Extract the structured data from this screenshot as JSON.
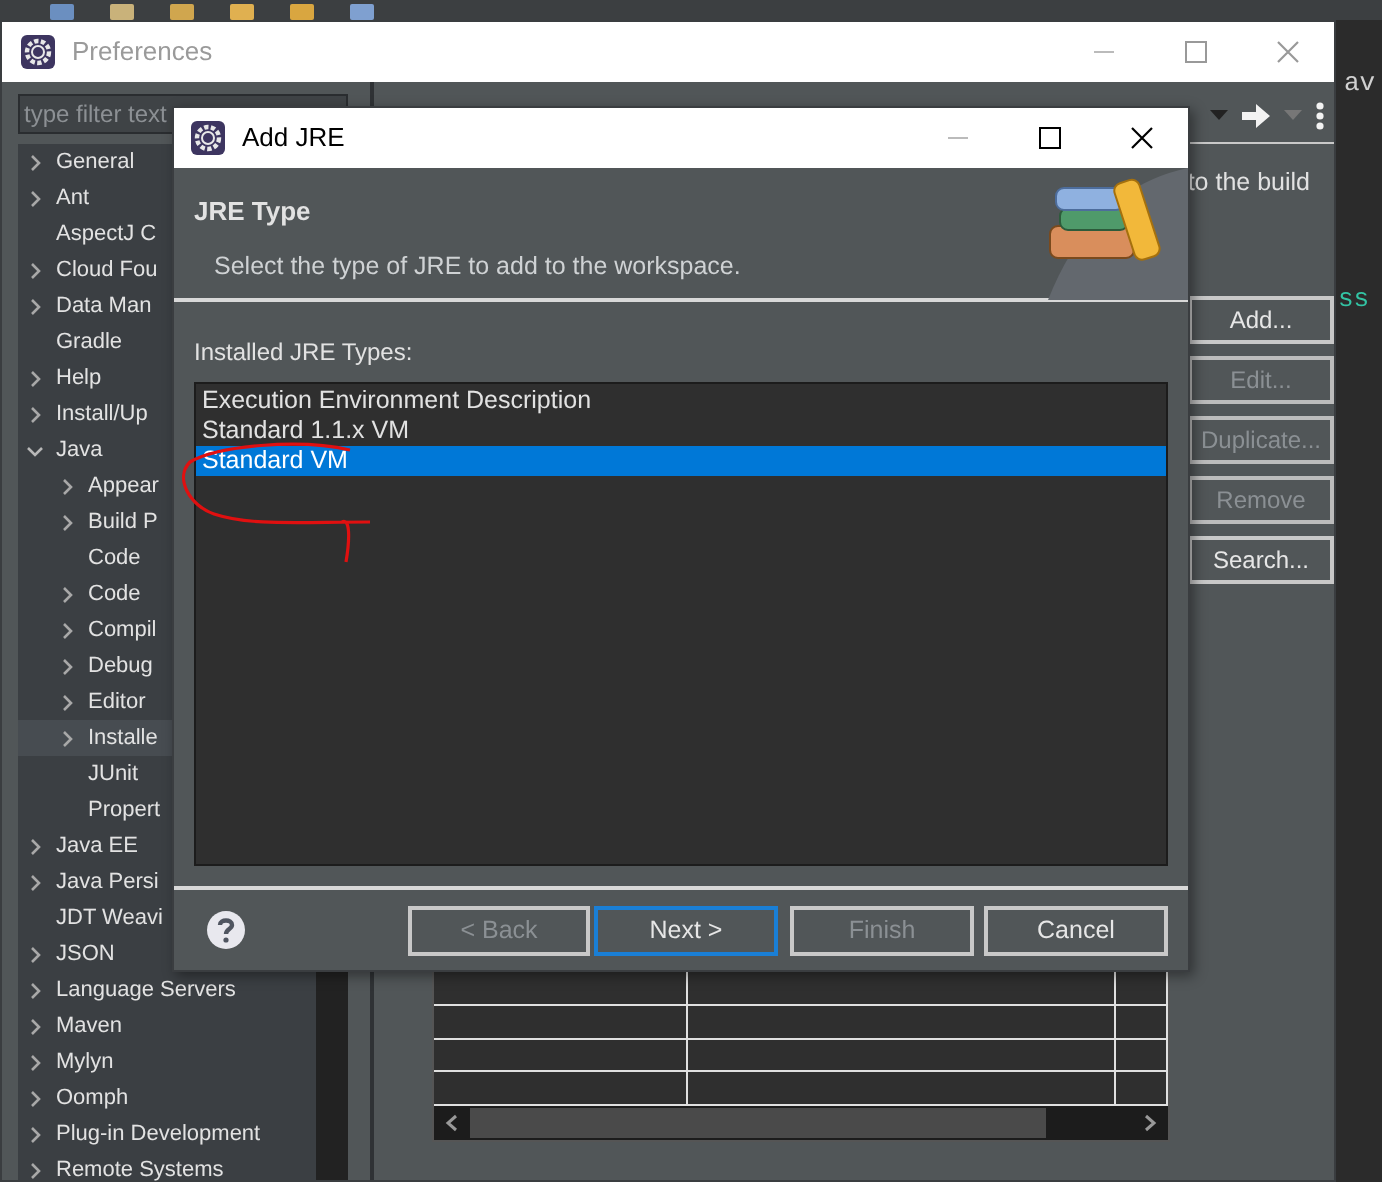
{
  "editor": {
    "fragments": [
      {
        "text": "av",
        "kind": "plain"
      },
      {
        "text": "ss",
        "kind": "keyword"
      }
    ]
  },
  "preferences": {
    "title": "Preferences",
    "filter": {
      "placeholder": "type filter text"
    },
    "tree": [
      {
        "label": "General",
        "expanded": false,
        "selected": false
      },
      {
        "label": "Ant",
        "expanded": false,
        "selected": false
      },
      {
        "label": "AspectJ C",
        "selected": false
      },
      {
        "label": "Cloud Fou",
        "expanded": false,
        "selected": false
      },
      {
        "label": "Data Man",
        "expanded": false,
        "selected": false
      },
      {
        "label": "Gradle",
        "selected": false
      },
      {
        "label": "Help",
        "expanded": false,
        "selected": false
      },
      {
        "label": "Install/Up",
        "expanded": false,
        "selected": false
      },
      {
        "label": "Java",
        "expanded": true,
        "selected": false,
        "children": [
          {
            "label": "Appear",
            "expanded": false,
            "selected": false
          },
          {
            "label": "Build P",
            "expanded": false,
            "selected": false
          },
          {
            "label": "Code",
            "selected": false
          },
          {
            "label": "Code",
            "expanded": false,
            "selected": false
          },
          {
            "label": "Compil",
            "expanded": false,
            "selected": false
          },
          {
            "label": "Debug",
            "expanded": false,
            "selected": false
          },
          {
            "label": "Editor",
            "expanded": false,
            "selected": false
          },
          {
            "label": "Installe",
            "expanded": false,
            "selected": true
          },
          {
            "label": "JUnit",
            "selected": false
          },
          {
            "label": "Propert",
            "selected": false
          }
        ]
      },
      {
        "label": "Java EE",
        "expanded": false,
        "selected": false
      },
      {
        "label": "Java Persi",
        "expanded": false,
        "selected": false
      },
      {
        "label": "JDT Weavi",
        "selected": false
      },
      {
        "label": "JSON",
        "expanded": false,
        "selected": false
      },
      {
        "label": "Language Servers",
        "expanded": false,
        "selected": false
      },
      {
        "label": "Maven",
        "expanded": false,
        "selected": false
      },
      {
        "label": "Mylyn",
        "expanded": false,
        "selected": false
      },
      {
        "label": "Oomph",
        "expanded": false,
        "selected": false
      },
      {
        "label": "Plug-in Development",
        "expanded": false,
        "selected": false
      },
      {
        "label": "Remote Systems",
        "expanded": false,
        "selected": false
      }
    ],
    "description": "to the build",
    "buttons": [
      {
        "label": "Add...",
        "disabled": false
      },
      {
        "label": "Edit...",
        "disabled": true
      },
      {
        "label": "Duplicate...",
        "disabled": true
      },
      {
        "label": "Remove",
        "disabled": true
      },
      {
        "label": "Search...",
        "disabled": false
      }
    ]
  },
  "dialog": {
    "title": "Add JRE",
    "header": {
      "title": "JRE Type",
      "description": "Select the type of JRE to add to the workspace."
    },
    "list_label": "Installed JRE Types:",
    "jre_types": [
      {
        "label": "Execution Environment Description",
        "selected": false
      },
      {
        "label": "Standard 1.1.x VM",
        "selected": false
      },
      {
        "label": "Standard VM",
        "selected": true
      }
    ],
    "buttons": [
      {
        "label": "< Back",
        "disabled": true,
        "default": false
      },
      {
        "label": "Next >",
        "disabled": false,
        "default": true
      },
      {
        "label": "Finish",
        "disabled": true,
        "default": false
      },
      {
        "label": "Cancel",
        "disabled": false,
        "default": false
      }
    ]
  }
}
